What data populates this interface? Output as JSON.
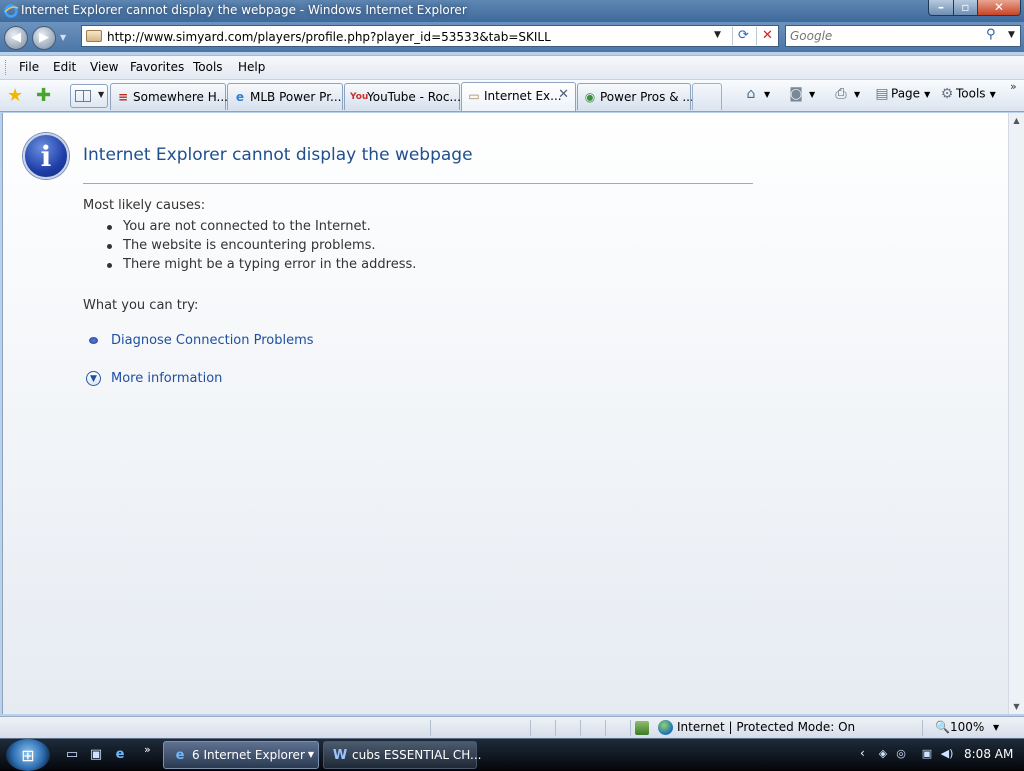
{
  "window": {
    "title": "Internet Explorer cannot display the webpage - Windows Internet Explorer",
    "minimize": "–",
    "maximize": "▫",
    "close": "✕"
  },
  "nav": {
    "back": "◀",
    "forward": "▶",
    "url": "http://www.simyard.com/players/profile.php?player_id=53533&tab=SKILL",
    "refresh_icon": "refresh-icon",
    "stop_icon": "stop-icon"
  },
  "search": {
    "placeholder": "Google"
  },
  "menu": {
    "items": [
      "File",
      "Edit",
      "View",
      "Favorites",
      "Tools",
      "Help"
    ]
  },
  "tabs": [
    {
      "label": "Somewhere H...",
      "icon": "red-bars-icon",
      "active": false
    },
    {
      "label": "MLB Power Pr...",
      "icon": "ie-icon",
      "active": false
    },
    {
      "label": "YouTube - Roc...",
      "icon": "youtube-icon",
      "active": false
    },
    {
      "label": "Internet Ex...",
      "icon": "page-icon",
      "active": true
    },
    {
      "label": "Power Pros & ...",
      "icon": "globe-icon",
      "active": false
    }
  ],
  "commandbar": {
    "page": "Page",
    "tools": "Tools"
  },
  "error": {
    "title": "Internet Explorer cannot display the webpage",
    "causes_heading": "Most likely causes:",
    "causes": [
      "You are not connected to the Internet.",
      "The website is encountering problems.",
      "There might be a typing error in the address."
    ],
    "try_heading": "What you can try:",
    "diagnose_link": "Diagnose Connection Problems",
    "more_link": "More information"
  },
  "status": {
    "zone": "Internet | Protected Mode: On",
    "zoom": "100%"
  },
  "taskbar": {
    "buttons": [
      {
        "label": "6 Internet Explorer",
        "active": true
      },
      {
        "label": "cubs ESSENTIAL CH...",
        "active": false
      }
    ],
    "clock": "8:08 AM"
  },
  "colors": {
    "link": "#1f4f9f",
    "title_text": "#1f4f8f",
    "titlebar": "#3e6a9c"
  }
}
